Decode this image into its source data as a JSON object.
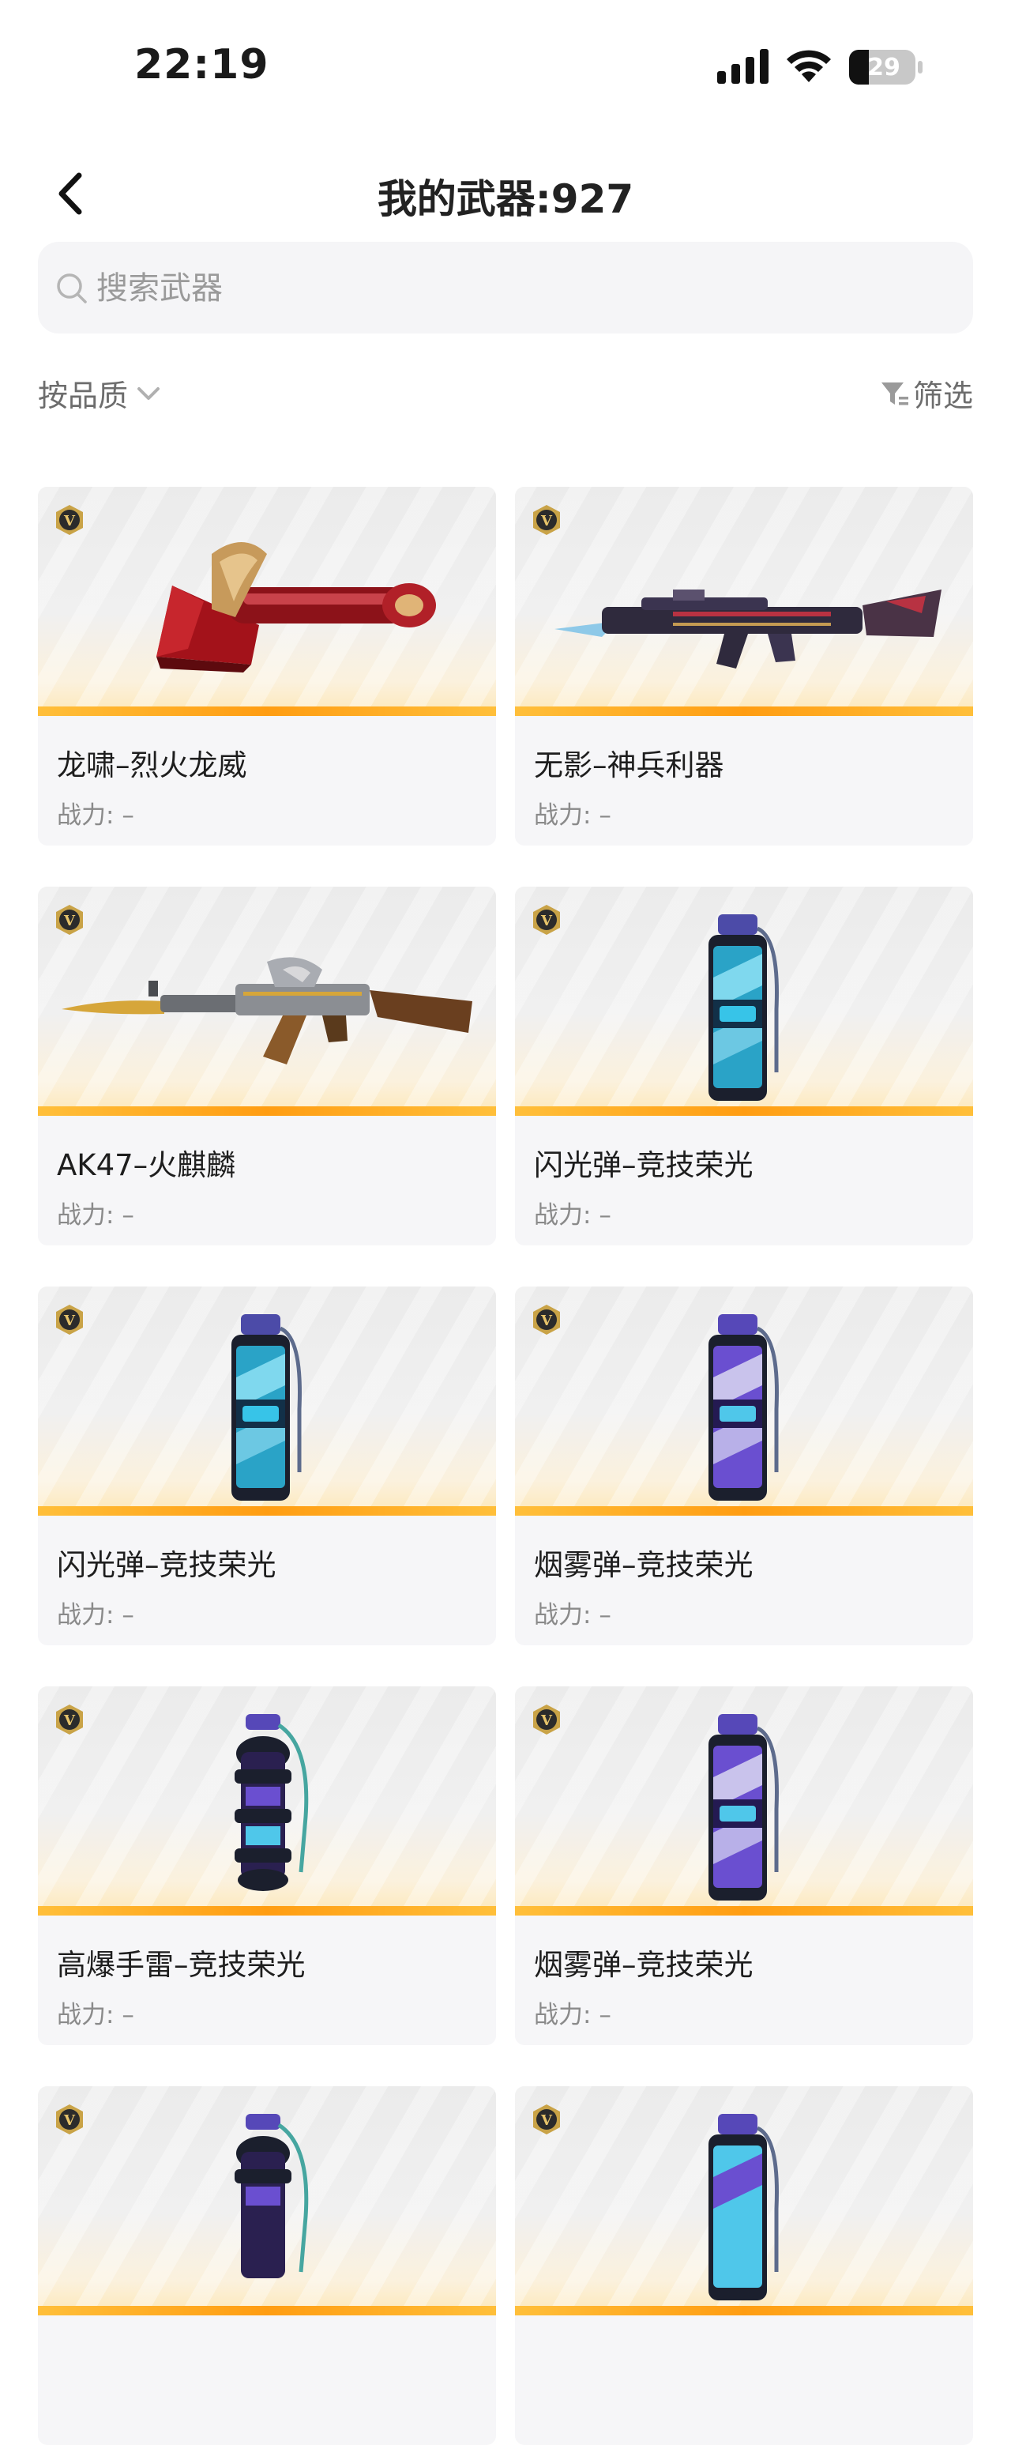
{
  "status_bar": {
    "time": "22:19",
    "battery_level": "29"
  },
  "header": {
    "title": "我的武器:927"
  },
  "search": {
    "placeholder": "搜索武器",
    "value": ""
  },
  "sort": {
    "label": "按品质"
  },
  "filter": {
    "label": "筛选"
  },
  "weapons": [
    {
      "name": "龙啸–烈火龙威",
      "power_label": "战力:",
      "power": "–",
      "badge": "V",
      "art": "axe-icon"
    },
    {
      "name": "无影–神兵利器",
      "power_label": "战力:",
      "power": "–",
      "badge": "V",
      "art": "rifle-icon"
    },
    {
      "name": "AK47–火麒麟",
      "power_label": "战力:",
      "power": "–",
      "badge": "V",
      "art": "rifle-icon"
    },
    {
      "name": "闪光弹–竞技荣光",
      "power_label": "战力:",
      "power": "–",
      "badge": "V",
      "art": "grenade-icon"
    },
    {
      "name": "闪光弹–竞技荣光",
      "power_label": "战力:",
      "power": "–",
      "badge": "V",
      "art": "grenade-icon"
    },
    {
      "name": "烟雾弹–竞技荣光",
      "power_label": "战力:",
      "power": "–",
      "badge": "V",
      "art": "grenade-icon"
    },
    {
      "name": "高爆手雷–竞技荣光",
      "power_label": "战力:",
      "power": "–",
      "badge": "V",
      "art": "grenade-icon"
    },
    {
      "name": "烟雾弹–竞技荣光",
      "power_label": "战力:",
      "power": "–",
      "badge": "V",
      "art": "grenade-icon"
    },
    {
      "name": "",
      "power_label": "",
      "power": "",
      "badge": "V",
      "art": "grenade-icon"
    },
    {
      "name": "",
      "power_label": "",
      "power": "",
      "badge": "V",
      "art": "grenade-icon"
    }
  ],
  "colors": {
    "accent": "#ff9d12",
    "card_bg": "#f6f6f8",
    "search_bg": "#f5f5f7",
    "badge": "#b08a2e"
  }
}
